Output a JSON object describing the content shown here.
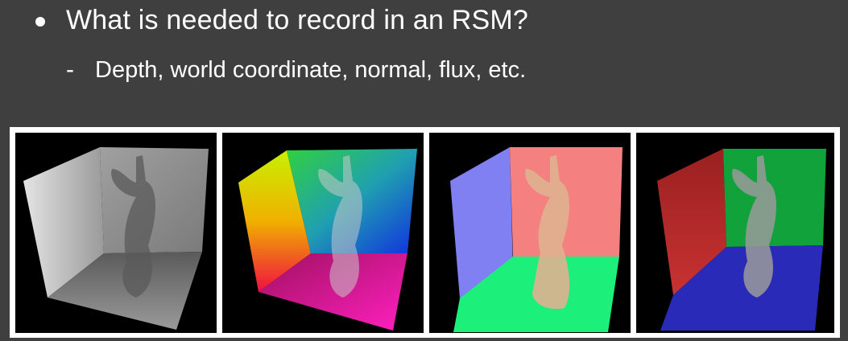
{
  "slide": {
    "bullet": "What is needed to record in an RSM?",
    "sub_bullet": "Depth, world coordinate, normal, flux, etc."
  },
  "images": [
    {
      "name": "depth-map",
      "palette": {
        "back": "#8e8e8e",
        "left": "#cfcfcf",
        "floor": "#6a6a6a"
      }
    },
    {
      "name": "world-coordinate-map",
      "palette": {
        "back": "#1ea0a0",
        "left": "#ffe600",
        "floor": "#e60090"
      }
    },
    {
      "name": "normal-map",
      "palette": {
        "back": "#f48080",
        "left": "#8080f2",
        "floor": "#1cf07a"
      }
    },
    {
      "name": "flux-map",
      "palette": {
        "back": "#12a23c",
        "left": "#b8282a",
        "floor": "#2a2ab8"
      }
    }
  ],
  "colors": {
    "background": "#3f3f3f",
    "text": "#ffffff",
    "frame": "#ffffff"
  }
}
